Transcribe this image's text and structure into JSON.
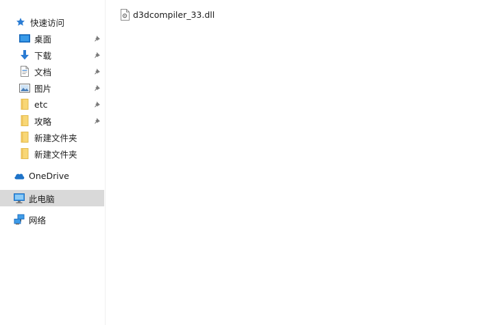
{
  "sidebar": {
    "quick_access": {
      "label": "快速访问",
      "icon": "star-icon",
      "accent": "#2b7cd3"
    },
    "pinned": [
      {
        "label": "桌面",
        "icon": "desktop-icon"
      },
      {
        "label": "下载",
        "icon": "download-icon"
      },
      {
        "label": "文档",
        "icon": "document-icon"
      },
      {
        "label": "图片",
        "icon": "pictures-icon"
      },
      {
        "label": "etc",
        "icon": "folder-icon"
      },
      {
        "label": "攻略",
        "icon": "folder-icon"
      },
      {
        "label": "新建文件夹",
        "icon": "folder-icon"
      },
      {
        "label": "新建文件夹",
        "icon": "folder-icon"
      }
    ],
    "onedrive": {
      "label": "OneDrive",
      "icon": "cloud-icon"
    },
    "this_pc": {
      "label": "此电脑",
      "icon": "computer-icon",
      "selected": true
    },
    "network": {
      "label": "网络",
      "icon": "network-icon"
    }
  },
  "content": {
    "files": [
      {
        "name": "d3dcompiler_33.dll",
        "icon": "dll-file-icon"
      }
    ]
  },
  "colors": {
    "selected_bg": "#d9d9d9",
    "folder": "#f8d775",
    "accent_blue": "#2b7cd3"
  }
}
